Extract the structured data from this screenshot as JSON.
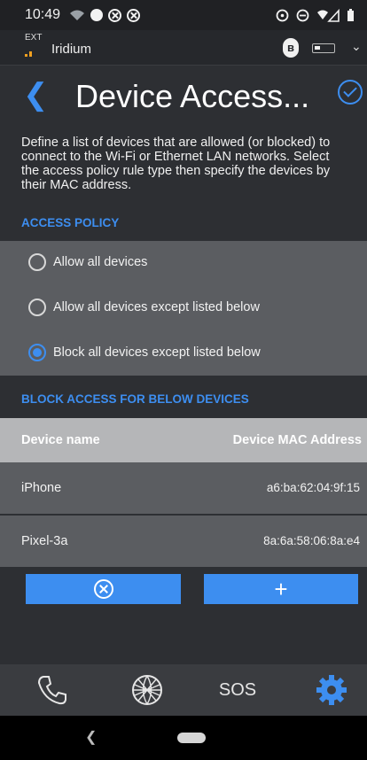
{
  "status_bar": {
    "time": "10:49",
    "icons": [
      "wifi-icon",
      "circle-icon",
      "block-icon",
      "block-icon",
      "alarm-icon",
      "dnd-icon",
      "signal-icon",
      "battery-icon"
    ]
  },
  "connection_bar": {
    "ext_label": "EXT",
    "network_name": "Iridium",
    "bluetooth_icon": "bluetooth-icon",
    "battery_icon": "battery-icon",
    "chevron_icon": "chevron-down-icon"
  },
  "header": {
    "title": "Device Access...",
    "back_icon": "back-arrow-icon",
    "confirm_icon": "check-circle-icon"
  },
  "description": "Define a list of devices that are allowed (or blocked) to connect to the Wi-Fi or Ethernet LAN networks. Select the access policy rule type then specify the devices by their MAC address.",
  "access_policy": {
    "heading": "ACCESS POLICY",
    "options": [
      {
        "label": "Allow all devices",
        "selected": false
      },
      {
        "label": "Allow all devices except listed below",
        "selected": false
      },
      {
        "label": "Block all devices except listed below",
        "selected": true
      }
    ]
  },
  "device_list": {
    "heading": "BLOCK ACCESS FOR BELOW DEVICES",
    "columns": [
      "Device name",
      "Device MAC Address"
    ],
    "rows": [
      {
        "name": "iPhone",
        "mac": "a6:ba:62:04:9f:15"
      },
      {
        "name": "Pixel-3a",
        "mac": "8a:6a:58:06:8a:e4"
      }
    ]
  },
  "actions": {
    "remove_icon": "circle-x-icon",
    "add_label": "+"
  },
  "tab_bar": {
    "tabs": [
      {
        "icon": "phone-icon"
      },
      {
        "icon": "globe-icon"
      },
      {
        "label": "SOS"
      },
      {
        "icon": "gear-icon",
        "active": true
      }
    ]
  },
  "colors": {
    "accent": "#3d8ef0",
    "background": "#2d2f33",
    "panel": "#5b5d61"
  }
}
